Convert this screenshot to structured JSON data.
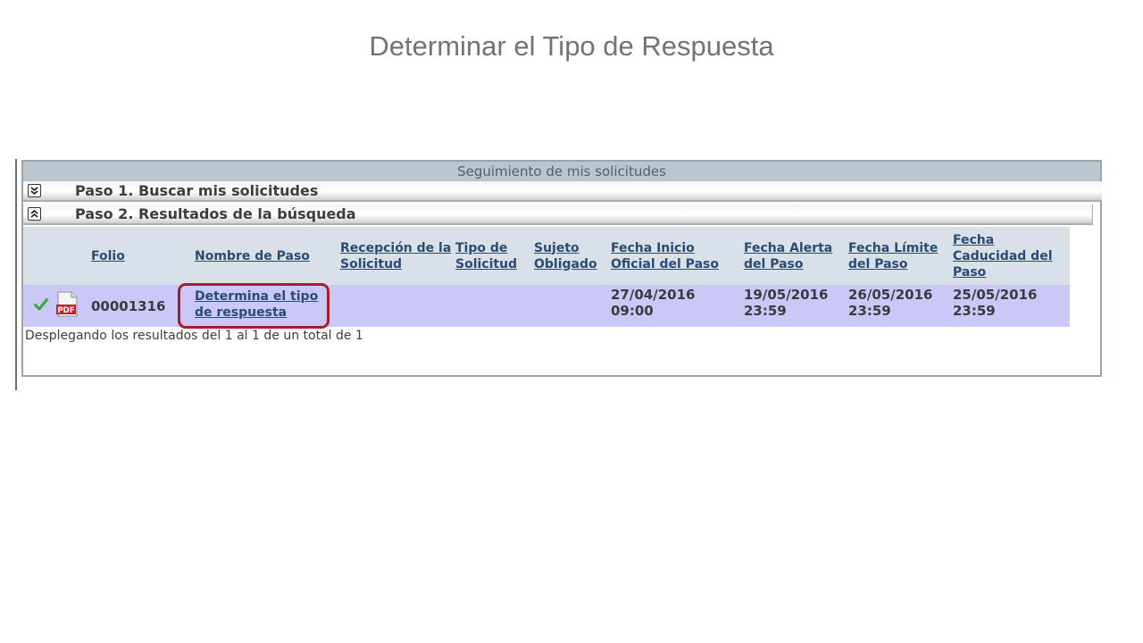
{
  "slide": {
    "title": "Determinar el Tipo de Respuesta"
  },
  "panel": {
    "header": "Seguimiento de mis solicitudes",
    "step1": "Paso 1. Buscar mis solicitudes",
    "step2": "Paso 2. Resultados de la búsqueda"
  },
  "table": {
    "columns": [
      "Folio",
      "Nombre de Paso",
      "Recepción de la Solicitud",
      "Tipo de Solicitud",
      "Sujeto Obligado",
      "Fecha Inicio Oficial del Paso",
      "Fecha Alerta del Paso",
      "Fecha Límite del Paso",
      "Fecha Caducidad del Paso"
    ],
    "rows": [
      {
        "status_icon": "check-icon",
        "file_icon": "pdf-icon",
        "file_icon_label": "PDF",
        "folio": "00001316",
        "step_name": "Determina el tipo de respuesta",
        "reception": "",
        "request_type": "",
        "subject": "",
        "start_date": "27/04/2016 09:00",
        "alert_date": "19/05/2016 23:59",
        "limit_date": "26/05/2016 23:59",
        "expiry_date": "25/05/2016 23:59"
      }
    ]
  },
  "footer": {
    "text": "Desplegando los resultados del 1 al 1 de un total de 1"
  },
  "colors": {
    "accent_link": "#2c4a73",
    "row_highlight": "#c9c8f8",
    "callout_border": "#a81c2c",
    "check": "#3aa53a",
    "pdf_red": "#c8212b"
  }
}
